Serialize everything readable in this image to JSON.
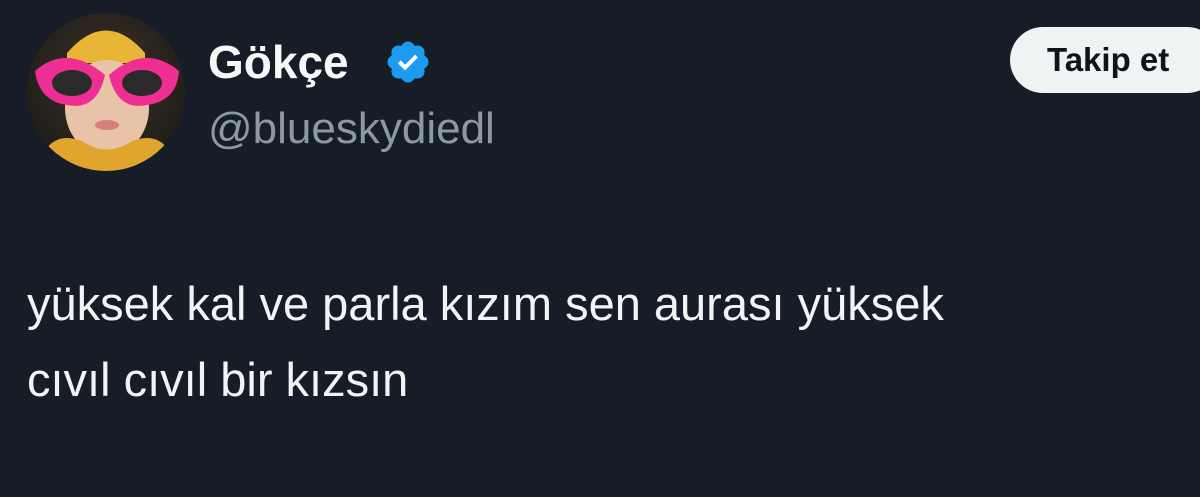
{
  "author": {
    "display_name": "Gökçe",
    "handle": "@blueskydiedl",
    "avatar_icon": "profile-photo-pink-glasses",
    "verified_icon": "verified-badge-icon",
    "verified_color": "#1d9bf0"
  },
  "actions": {
    "follow_label": "Takip et"
  },
  "tweet": {
    "lines": [
      "yüksek kal ve parla kızım sen aurası yüksek",
      "cıvıl cıvıl bir kızsın"
    ]
  },
  "colors": {
    "background": "#161d27",
    "text": "#f1f3f4",
    "secondary_text": "#8b98a5",
    "button_bg": "#eff3f4"
  }
}
